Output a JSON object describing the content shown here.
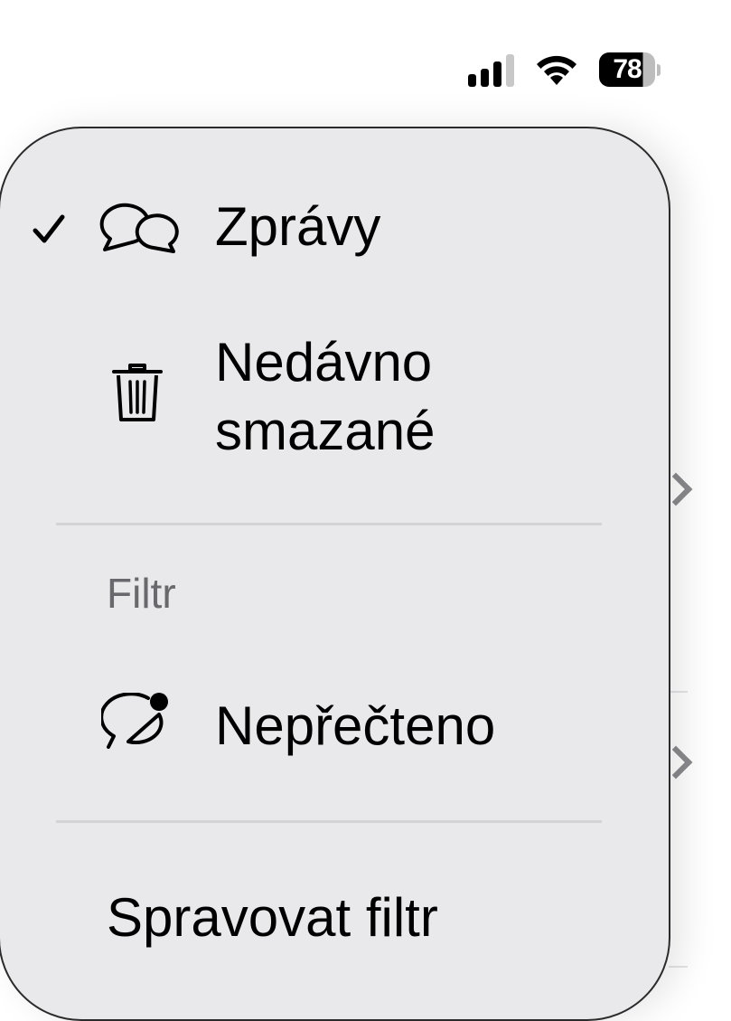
{
  "status_bar": {
    "battery_level": "78",
    "signal_icon": "cellular-signal-icon",
    "wifi_icon": "wifi-icon",
    "battery_icon": "battery-icon"
  },
  "menu": {
    "items": [
      {
        "label": "Zprávy",
        "icon": "message-bubbles-icon",
        "selected": true
      },
      {
        "label_line1": "Nedávno",
        "label_line2": "smazané",
        "icon": "trash-icon",
        "selected": false
      }
    ],
    "filter_header": "Filtr",
    "filter_items": [
      {
        "label": "Nepřečteno",
        "icon": "unread-message-icon"
      }
    ],
    "manage_label": "Spravovat filtr"
  },
  "colors": {
    "menu_background": "#e9e9eb",
    "separator": "#d3d3d6",
    "section_header": "#68686d",
    "chevron": "#8a8a8e"
  }
}
